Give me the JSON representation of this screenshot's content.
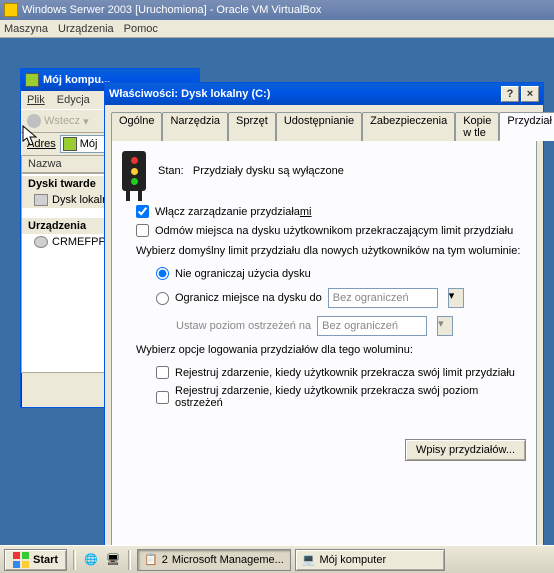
{
  "vbox": {
    "title": "Windows Serwer 2003 [Uruchomiona] - Oracle VM VirtualBox",
    "menu": {
      "m1": "Maszyna",
      "m2": "Urządzenia",
      "m3": "Pomoc"
    }
  },
  "explorer": {
    "title": "Mój kompu...",
    "menu": {
      "file": "Plik",
      "edit": "Edycja"
    },
    "back": "Wstecz",
    "addr_label": "Adres",
    "addr_value": "Mój",
    "col_header": "Nazwa",
    "group_disks": "Dyski twarde",
    "item_disk": "Dysk lokaln",
    "group_devices": "Urządzenia",
    "item_device": "CRMEFPP_E"
  },
  "props": {
    "title": "Właściwości: Dysk lokalny (C:)",
    "tabs": {
      "t1": "Ogólne",
      "t2": "Narzędzia",
      "t3": "Sprzęt",
      "t4": "Udostępnianie",
      "t5": "Zabezpieczenia",
      "t6": "Kopie w tle",
      "t7": "Przydział"
    },
    "status_label": "Stan:",
    "status_value": "Przydziały dysku są wyłączone",
    "chk_enable_pre": "Włącz zarządzanie przydziała",
    "chk_enable_suf": "mi",
    "chk_deny": "Odmów miejsca na dysku użytkownikom przekraczającym limit przydziału",
    "desc": "Wybierz domyślny limit przydziału dla nowych użytkowników na tym woluminie:",
    "radio_unlimited": "Nie ograniczaj użycia dysku",
    "radio_limit": "Ogranicz miejsce na dysku do",
    "warn_label": "Ustaw poziom ostrzeżeń na",
    "no_limit": "Bez ograniczeń",
    "log_desc": "Wybierz opcje logowania przydziałów dla tego woluminu:",
    "chk_log_limit": "Rejestruj zdarzenie, kiedy użytkownik przekracza swój limit przydziału",
    "chk_log_warn": "Rejestruj zdarzenie, kiedy użytkownik przekracza swój poziom ostrzeżeń",
    "btn_entries": "Wpisy przydziałów...",
    "help_btn": "?",
    "close_btn": "×"
  },
  "taskbar": {
    "start": "Start",
    "task1_count": "2",
    "task1": "Microsoft Manageme...",
    "task2": "Mój komputer"
  }
}
